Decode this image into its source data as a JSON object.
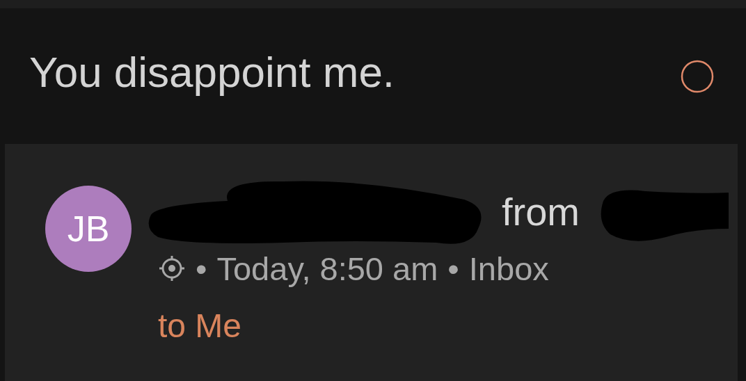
{
  "header": {
    "title": "You disappoint me."
  },
  "message": {
    "avatar": {
      "initials": "JB",
      "color": "#ad7dbd"
    },
    "sender_line": [
      {
        "kind": "redaction"
      },
      {
        "kind": "text",
        "text": "from"
      },
      {
        "kind": "redaction"
      }
    ],
    "meta": [
      {
        "kind": "icon"
      },
      {
        "kind": "text",
        "text": "•"
      },
      {
        "kind": "text",
        "text": "Today, 8:50 am"
      },
      {
        "kind": "text",
        "text": "•"
      },
      {
        "kind": "text",
        "text": "Inbox"
      }
    ],
    "recipient": "to Me"
  }
}
